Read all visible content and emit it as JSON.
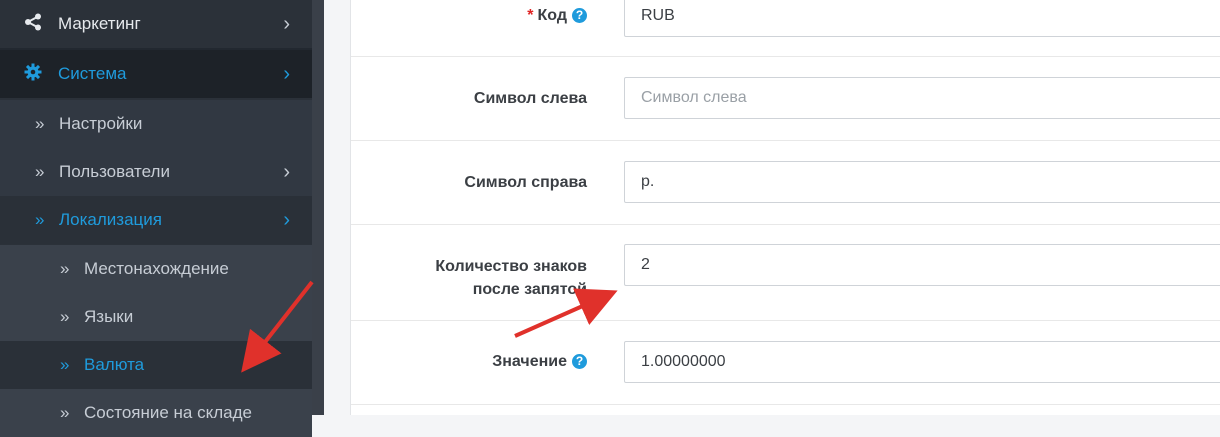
{
  "sidebar": {
    "items": [
      {
        "label": "Маркетинг",
        "icon": "share-icon"
      },
      {
        "label": "Система",
        "icon": "gear-icon"
      },
      {
        "label": "Настройки"
      },
      {
        "label": "Пользователи"
      },
      {
        "label": "Локализация"
      },
      {
        "label": "Местонахождение"
      },
      {
        "label": "Языки"
      },
      {
        "label": "Валюта"
      },
      {
        "label": "Состояние на складе"
      }
    ],
    "colors": {
      "bg": "#2b3139",
      "active": "#1f9bdc"
    }
  },
  "form": {
    "code": {
      "label": "Код",
      "required_mark": "*",
      "value": "RUB"
    },
    "symbol_left": {
      "label": "Символ слева",
      "placeholder": "Символ слева"
    },
    "symbol_right": {
      "label": "Символ справа",
      "value": "р."
    },
    "decimal_places": {
      "label_line1": "Количество знаков",
      "label_line2": "после запятой",
      "value": "2"
    },
    "value": {
      "label": "Значение",
      "value": "1.00000000"
    }
  },
  "annotation_color": "#e0312b"
}
